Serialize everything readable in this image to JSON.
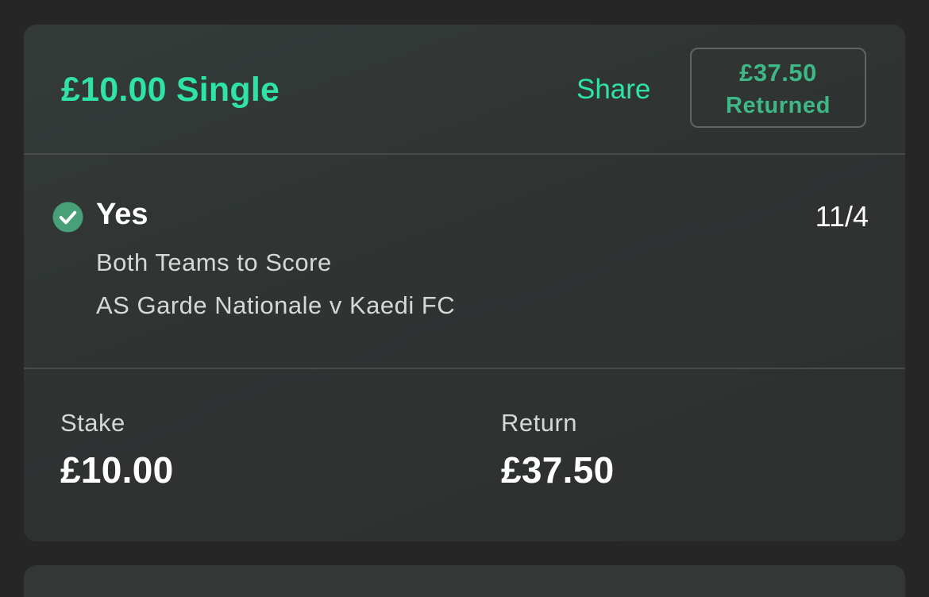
{
  "bet": {
    "title": "£10.00 Single",
    "share_label": "Share",
    "returned": {
      "amount": "£37.50",
      "label": "Returned"
    }
  },
  "selection": {
    "status_icon": "check-circle-icon",
    "name": "Yes",
    "odds": "11/4",
    "market": "Both Teams to Score",
    "event": "AS Garde Nationale v Kaedi FC"
  },
  "summary": {
    "stake_label": "Stake",
    "stake_value": "£10.00",
    "return_label": "Return",
    "return_value": "£37.50"
  },
  "colors": {
    "accent": "#2fe3a6",
    "returned_text": "#3fb888",
    "win_check": "#47a078",
    "background": "#262626",
    "card": "#303433"
  }
}
